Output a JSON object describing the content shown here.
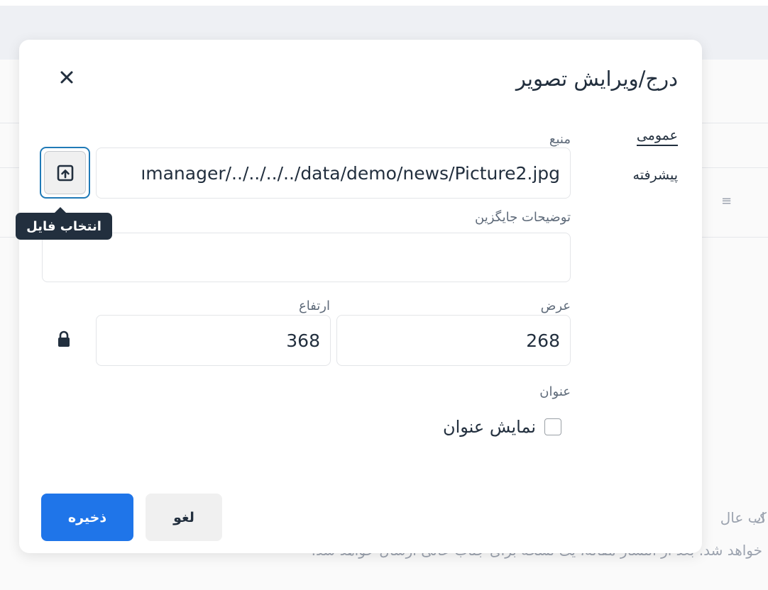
{
  "dialog": {
    "title": "درج/ویرایش تصویر",
    "close_icon": "close-icon"
  },
  "tabs": [
    {
      "label": "عمومی",
      "active": true
    },
    {
      "label": "پیشرفته",
      "active": false
    }
  ],
  "form": {
    "source": {
      "label": "منبع",
      "value": "ımanager/../../../../data/demo/news/Picture2.jpg"
    },
    "file_button": {
      "icon": "upload-icon",
      "tooltip": "انتخاب فایل"
    },
    "alt": {
      "label": "توضیحات جایگزین",
      "value": ""
    },
    "dimensions": {
      "width_label": "عرض",
      "width_value": "268",
      "height_label": "ارتفاع",
      "height_value": "368",
      "lock_icon": "lock-icon"
    },
    "caption": {
      "section_label": "عنوان",
      "checkbox_label": "نمایش عنوان",
      "checked": false
    }
  },
  "buttons": {
    "save": "ذخیره",
    "cancel": "لغو"
  },
  "background": {
    "line1_left": "ک",
    "line1_right": "اب عال",
    "line2": "خواهد شد. بعد از انتشار مقاله، یک نسخه برای جناب عالی ارسال خواهد شد."
  },
  "colors": {
    "primary": "#1f75e9",
    "dark_text": "#222f3e",
    "focus_border": "#207ab7"
  }
}
